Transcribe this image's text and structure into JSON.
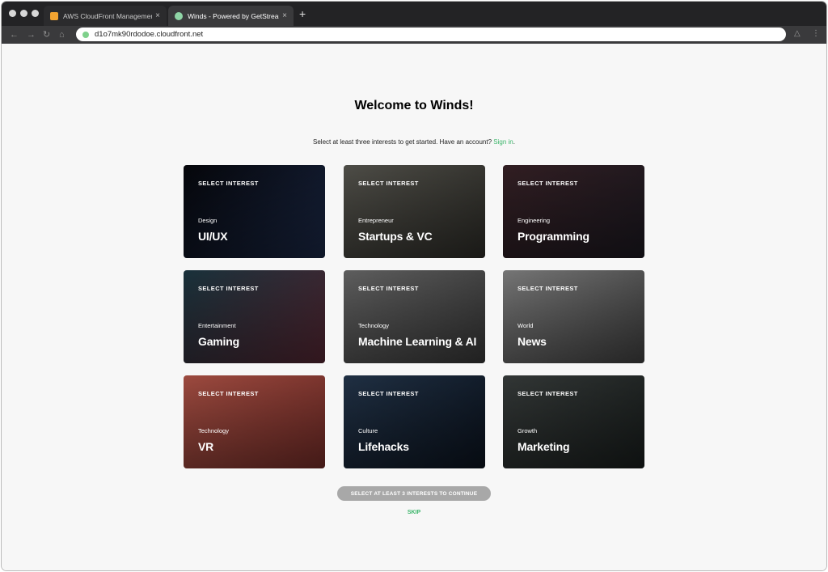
{
  "browser": {
    "tabs": [
      {
        "title": "AWS CloudFront Management",
        "favicon_color": "#f3a431",
        "active": false
      },
      {
        "title": "Winds - Powered by GetStream",
        "favicon_color": "#8fd5a6",
        "active": true
      }
    ],
    "new_tab": "+",
    "close_glyph": "×",
    "url": "d1o7mk90rdodoe.cloudfront.net"
  },
  "page": {
    "heading": "Welcome to Winds!",
    "subtitle_text": "Select at least three interests to get started. Have an account?",
    "signin_label": "Sign in",
    "subtitle_end": ".",
    "continue_label": "SELECT AT LEAST 3 INTERESTS TO CONTINUE",
    "skip_label": "SKIP"
  },
  "cards": [
    {
      "select": "SELECT INTEREST",
      "category": "Design",
      "name": "UI/UX",
      "colors": [
        "#06070c",
        "#1c2a4a"
      ]
    },
    {
      "select": "SELECT INTEREST",
      "category": "Entrepreneur",
      "name": "Startups & VC",
      "colors": [
        "#5b5a53",
        "#2f2e29"
      ]
    },
    {
      "select": "SELECT INTEREST",
      "category": "Engineering",
      "name": "Programming",
      "colors": [
        "#3a2328",
        "#1d1a22"
      ]
    },
    {
      "select": "SELECT INTEREST",
      "category": "Entertainment",
      "name": "Gaming",
      "colors": [
        "#1d3a45",
        "#5a2835"
      ]
    },
    {
      "select": "SELECT INTEREST",
      "category": "Technology",
      "name": "Machine Learning & AI",
      "colors": [
        "#6e6e6e",
        "#3b3b3b"
      ]
    },
    {
      "select": "SELECT INTEREST",
      "category": "World",
      "name": "News",
      "colors": [
        "#8a8a8a",
        "#444444"
      ]
    },
    {
      "select": "SELECT INTEREST",
      "category": "Technology",
      "name": "VR",
      "colors": [
        "#b8574a",
        "#7a2f2a"
      ]
    },
    {
      "select": "SELECT INTEREST",
      "category": "Culture",
      "name": "Lifehacks",
      "colors": [
        "#25384f",
        "#0c1420"
      ]
    },
    {
      "select": "SELECT INTEREST",
      "category": "Growth",
      "name": "Marketing",
      "colors": [
        "#3b403f",
        "#1a1f1e"
      ]
    }
  ]
}
